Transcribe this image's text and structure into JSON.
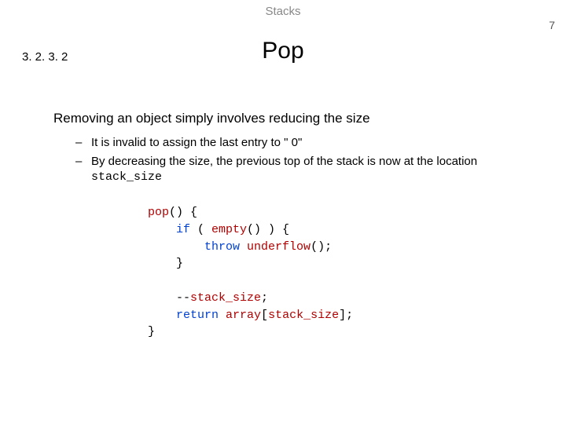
{
  "header": {
    "topic": "Stacks",
    "page_number": "7"
  },
  "section_number": "3. 2. 3. 2",
  "title": "Pop",
  "lead": "Removing an object simply involves reducing the size",
  "bullets": [
    {
      "dash": "–",
      "text": "It is invalid to assign the last entry to \" 0\""
    },
    {
      "dash": "–",
      "text_a": "By decreasing the size, the previous top of the stack is now at the location ",
      "code": "stack_size"
    }
  ],
  "code": {
    "l1a": "pop",
    "l1b": "() {",
    "l2a": "    if",
    "l2b": " ( ",
    "l2c": "empty",
    "l2d": "() ) {",
    "l3a": "        throw",
    "l3b": " ",
    "l3c": "underflow",
    "l3d": "();",
    "l4": "    }",
    "blank": "",
    "l5a": "    --",
    "l5b": "stack_size",
    "l5c": ";",
    "l6a": "    return",
    "l6b": " ",
    "l6c": "array",
    "l6d": "[",
    "l6e": "stack_size",
    "l6f": "];",
    "l7": "}"
  }
}
